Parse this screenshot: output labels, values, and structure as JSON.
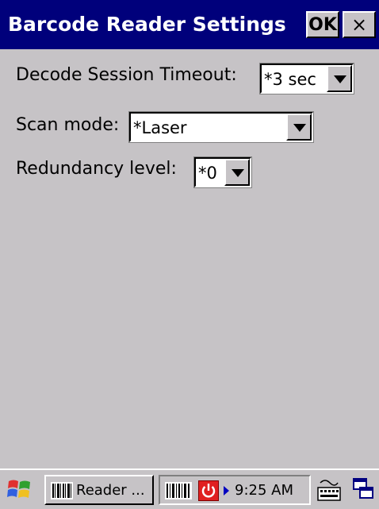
{
  "window": {
    "title": "Barcode Reader Settings",
    "ok_label": "OK",
    "close_label": "×"
  },
  "settings": {
    "decode_timeout": {
      "label": "Decode Session Timeout:",
      "value": "*3 sec"
    },
    "scan_mode": {
      "label": "Scan mode:",
      "value": "*Laser"
    },
    "redundancy": {
      "label": "Redundancy level:",
      "value": "*0"
    }
  },
  "taskbar": {
    "start_icon": "windows-flag-icon",
    "task_label": "Reader ...",
    "clock": "9:25 AM",
    "icons": [
      "barcode-icon",
      "power-icon",
      "keyboard-icon",
      "windows-switch-icon"
    ]
  },
  "colors": {
    "titlebar": "#00007b",
    "background": "#c6c3c6",
    "power": "#e02020"
  }
}
